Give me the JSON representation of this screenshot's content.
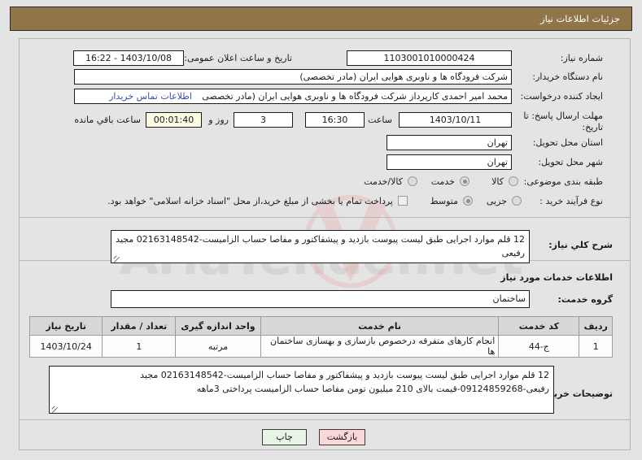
{
  "header": {
    "title": "جزئیات اطلاعات نیاز"
  },
  "watermark": {
    "text": "AriaTender.net"
  },
  "fields": {
    "need_number_label": "شماره نیاز:",
    "need_number_value": "1103001010000424",
    "public_announce_label": "تاریخ و ساعت اعلان عمومی:",
    "public_announce_value": "1403/10/08 - 16:22",
    "buyer_org_label": "نام دستگاه خریدار:",
    "buyer_org_value": "شرکت فرودگاه ها و ناوبری هوایی ایران (مادر تخصصی)",
    "buyer_org_value_left": "شرکت فرودگاه ها و ناوبری هوایی ایران (مادر تخصصی)",
    "creator_label": "ایجاد کننده درخواست:",
    "creator_value": "محمد امیر احمدی کارپرداز شرکت فرودگاه ها و ناوبری هوایی ایران (مادر تخصصی",
    "contact_link": "اطلاعات تماس خریدار",
    "deadline_label": "مهلت ارسال پاسخ: تا تاریخ:",
    "deadline_date": "1403/10/11",
    "time_word": "ساعت",
    "deadline_time": "16:30",
    "days_value": "3",
    "days_word": "روز و",
    "countdown_value": "00:01:40",
    "remaining_word": "ساعت باقي مانده",
    "province_label": "استان محل تحویل:",
    "province_value": "تهران",
    "city_label": "شهر محل تحویل:",
    "city_value": "تهران",
    "category_label": "طبقه بندی موضوعی:",
    "category_options": [
      "کالا",
      "خدمت",
      "کالا/خدمت"
    ],
    "category_selected": "خدمت",
    "process_label": "نوع فرآیند خرید :",
    "process_options": [
      "جزیی",
      "متوسط"
    ],
    "process_selected": "متوسط",
    "treasury_note": "پرداخت تمام یا بخشی از مبلغ خرید،از محل \"اسناد خزانه اسلامی\" خواهد بود."
  },
  "summary": {
    "label": "شرح کلي نیاز:",
    "value": "12 قلم موارد اجرایی طبق لیست پیوست بازدید و پیشفاکتور و مفاصا حساب الزامیست-02163148542 مجید رفیعی"
  },
  "services_section": {
    "title": "اطلاعات خدمات مورد نیاز",
    "group_label": "گروه خدمت:",
    "group_value": "ساختمان"
  },
  "table": {
    "headers": [
      "ردیف",
      "کد خدمت",
      "نام خدمت",
      "واحد اندازه گیری",
      "تعداد / مقدار",
      "تاریخ نیاز"
    ],
    "rows": [
      {
        "row": "1",
        "code": "ج-44",
        "name": "انجام کارهای متفرقه درخصوص بازسازی و بهسازی ساختمان ها",
        "unit": "مرتبه",
        "qty": "1",
        "date": "1403/10/24"
      }
    ]
  },
  "buyer_notes": {
    "label": "توضیحات خریدار:",
    "line1": "12 قلم موارد اجرایی طبق لیست پیوست بازدید و پیشفاکتور و مفاصا حساب الزامیست-02163148542 مجید",
    "line2": "رفیعی-09124859268-قیمت بالای 210 میلیون تومن مفاصا حساب الزامیست پرداختی 3ماهه"
  },
  "buttons": {
    "print": "چاپ",
    "back": "بازگشت"
  }
}
